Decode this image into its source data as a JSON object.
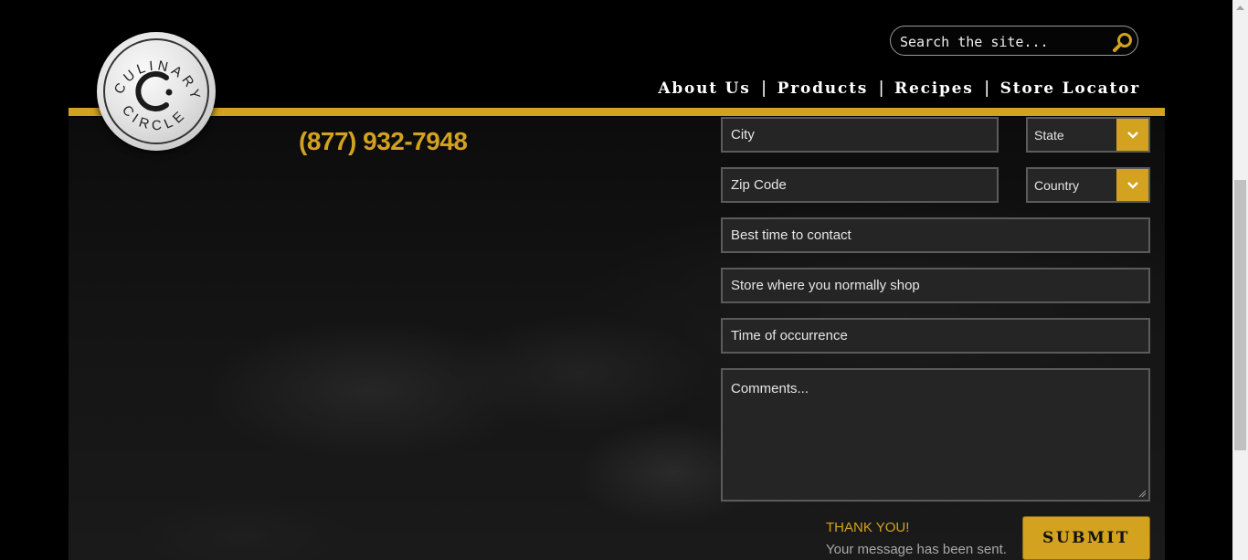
{
  "header": {
    "logo_text": "CULINARY CIRCLE",
    "phone": "(877) 932-7948",
    "search": {
      "placeholder": "Search the site..."
    },
    "nav": [
      {
        "label": "About Us"
      },
      {
        "label": "Products"
      },
      {
        "label": "Recipes"
      },
      {
        "label": "Store Locator"
      }
    ],
    "nav_separator": "|"
  },
  "form": {
    "city": {
      "placeholder": "City"
    },
    "state": {
      "selected": "State"
    },
    "zip": {
      "placeholder": "Zip Code"
    },
    "country": {
      "selected": "Country"
    },
    "best_time": {
      "placeholder": "Best time to contact"
    },
    "store": {
      "placeholder": "Store where you normally shop"
    },
    "occurrence": {
      "placeholder": "Time of occurrence"
    },
    "comments": {
      "placeholder": "Comments..."
    },
    "submit_label": "SUBMIT",
    "confirmation": {
      "title": "THANK YOU!",
      "message": "Your message has been sent."
    }
  },
  "colors": {
    "accent": "#d3a21e",
    "background": "#000000",
    "field_bg": "#252525",
    "field_border": "#5b5b5b"
  },
  "icons": [
    "search-icon",
    "chevron-down-icon",
    "resize-grip-icon",
    "scroll-up-arrow-icon"
  ]
}
